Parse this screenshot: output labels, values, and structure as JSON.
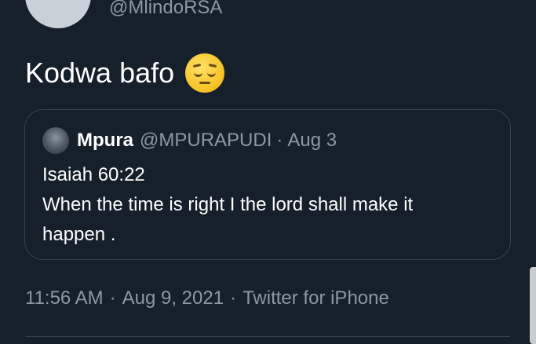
{
  "tweet": {
    "handle": "@MlindoRSA",
    "text": "Kodwa bafo",
    "emoji": "pensive-face-emoji"
  },
  "quoted_tweet": {
    "name": "Mpura",
    "handle": "@MPURAPUDI",
    "separator": "·",
    "date": "Aug 3",
    "lines": [
      "Isaiah 60:22",
      "When the time is right I the lord shall make it",
      "happen ."
    ]
  },
  "meta": {
    "time": "11:56 AM",
    "separator": "·",
    "date": "Aug 9, 2021",
    "source": "Twitter for iPhone"
  },
  "colors": {
    "background": "#15202b",
    "secondary_text": "#8b98a5",
    "border": "#38444d"
  }
}
